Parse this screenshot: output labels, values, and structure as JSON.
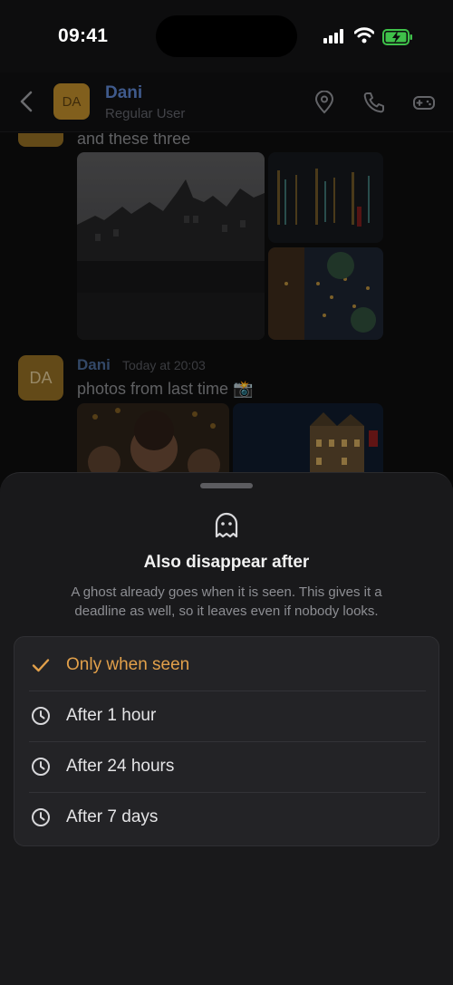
{
  "status_bar": {
    "time": "09:41"
  },
  "header": {
    "avatar_initials": "DA",
    "name": "Dani",
    "subtitle": "Regular User"
  },
  "chat": {
    "prev_message_text": "and these three",
    "message": {
      "avatar_initials": "DA",
      "sender": "Dani",
      "timestamp": "Today at 20:03",
      "text": "photos from last time 📸"
    }
  },
  "sheet": {
    "title": "Also disappear after",
    "description": "A ghost already goes when it is seen. This gives it a deadline as well, so it leaves even if nobody looks.",
    "options": [
      {
        "label": "Only when seen",
        "icon": "checkmark-icon",
        "selected": true
      },
      {
        "label": "After 1 hour",
        "icon": "clock-icon",
        "selected": false
      },
      {
        "label": "After 24 hours",
        "icon": "clock-icon",
        "selected": false
      },
      {
        "label": "After 7 days",
        "icon": "clock-icon",
        "selected": false
      }
    ]
  },
  "colors": {
    "accent": "#e2a04a",
    "name_blue": "#5b82c9",
    "avatar_gold": "#b9892a",
    "sheet_bg": "#19191b"
  }
}
